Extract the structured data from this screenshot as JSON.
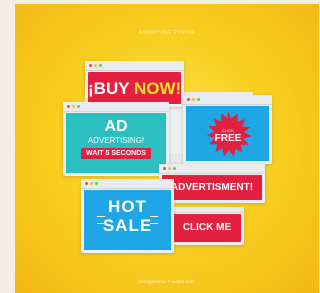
{
  "poster": {
    "heading": "ANNOYING POPUP",
    "credit": "Designed by Freepik.com"
  },
  "popups": {
    "buy_now": {
      "prefix": "¡BUY ",
      "emphasis": "NOW!"
    },
    "ad": {
      "title": "AD",
      "subtitle": "ADVERTISING!",
      "button": "WAIT 5 SECONDS"
    },
    "free": {
      "small": "CLICK",
      "big": "FREE"
    },
    "advertisment": {
      "text": "ADVERTISMENT!"
    },
    "hot_sale": {
      "line1": "HOT",
      "line2": "SALE"
    },
    "click_me": {
      "text": "CLICK ME"
    }
  },
  "colors": {
    "background": "#f8cf21",
    "red": "#e3203f",
    "teal": "#2cbfc0",
    "blue": "#1ea7e4",
    "yellow_text": "#fde227",
    "white": "#ffffff"
  },
  "icons": {
    "window_dots": [
      "red-dot",
      "yellow-dot",
      "green-dot"
    ],
    "starburst": "starburst-badge-icon"
  }
}
